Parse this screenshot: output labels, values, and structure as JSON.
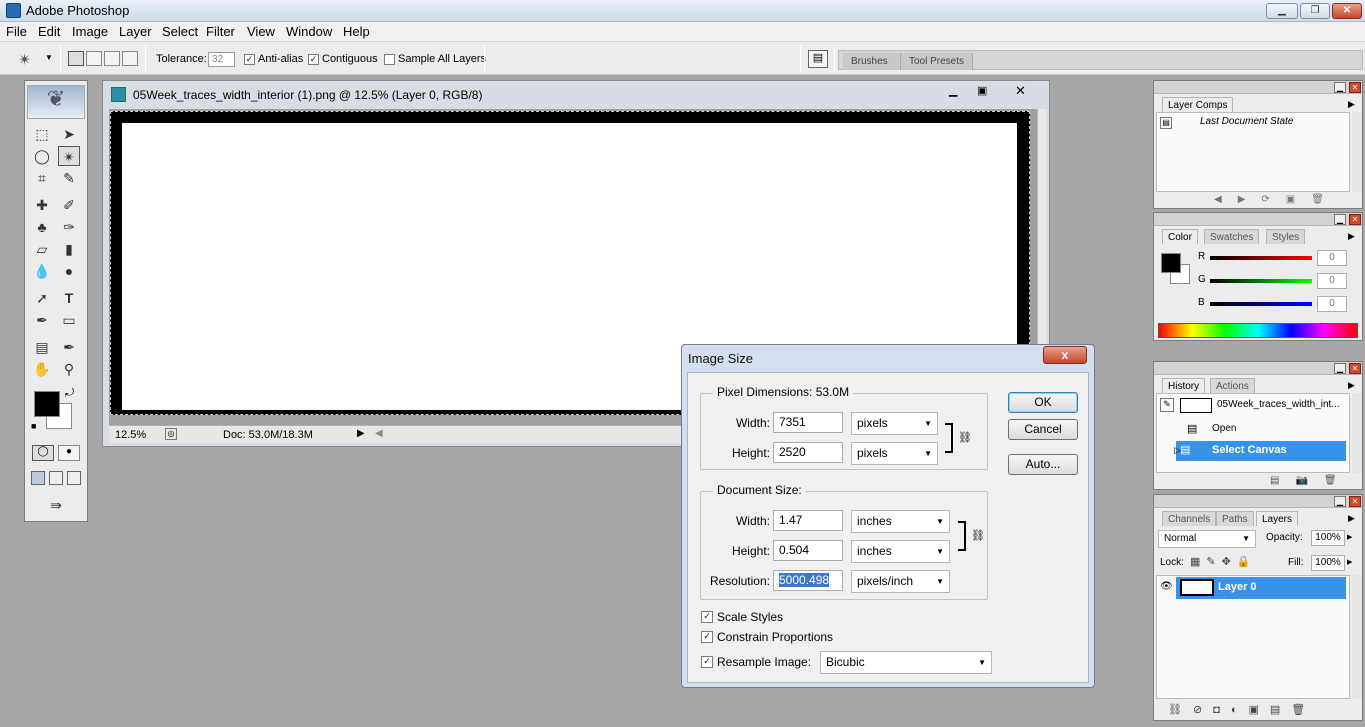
{
  "app": {
    "title": "Adobe Photoshop"
  },
  "menu": [
    "File",
    "Edit",
    "Image",
    "Layer",
    "Select",
    "Filter",
    "View",
    "Window",
    "Help"
  ],
  "options": {
    "tolerance_label": "Tolerance:",
    "tolerance_value": "32",
    "antialias_label": "Anti-alias",
    "contiguous_label": "Contiguous",
    "sample_all_label": "Sample All Layers",
    "antialias_checked": true,
    "contiguous_checked": true,
    "sample_all_checked": false
  },
  "well_tabs": [
    "Brushes",
    "Tool Presets"
  ],
  "document": {
    "title": "05Week_traces_width_interior (1).png @ 12.5% (Layer 0, RGB/8)",
    "zoom": "12.5%",
    "doc_info": "Doc: 53.0M/18.3M"
  },
  "dialog": {
    "title": "Image Size",
    "pixel_dims_label": "Pixel Dimensions:",
    "pixel_dims_value": "53.0M",
    "width_label": "Width:",
    "height_label": "Height:",
    "px_width": "7351",
    "px_height": "2520",
    "px_unit": "pixels",
    "doc_size_label": "Document Size:",
    "doc_width": "1.47",
    "doc_height": "0.504",
    "doc_unit": "inches",
    "resolution_label": "Resolution:",
    "resolution": "5000.498",
    "res_unit": "pixels/inch",
    "scale_styles": "Scale Styles",
    "constrain": "Constrain Proportions",
    "resample": "Resample Image:",
    "resample_method": "Bicubic",
    "ok": "OK",
    "cancel": "Cancel",
    "auto": "Auto...",
    "close": "x"
  },
  "layer_comps": {
    "tab": "Layer Comps",
    "row": "Last Document State"
  },
  "color_panel": {
    "tabs": [
      "Color",
      "Swatches",
      "Styles"
    ],
    "channels": [
      {
        "name": "R",
        "value": "0",
        "color": "#d62020"
      },
      {
        "name": "G",
        "value": "0",
        "color": "#22b022"
      },
      {
        "name": "B",
        "value": "0",
        "color": "#2020d6"
      }
    ]
  },
  "history_panel": {
    "tabs": [
      "History",
      "Actions"
    ],
    "snapshot": "05Week_traces_width_int...",
    "items": [
      "Open",
      "Select Canvas"
    ]
  },
  "layers_panel": {
    "tabs": [
      "Channels",
      "Paths",
      "Layers"
    ],
    "blend_mode": "Normal",
    "opacity_label": "Opacity:",
    "opacity": "100%",
    "lock_label": "Lock:",
    "fill_label": "Fill:",
    "fill": "100%",
    "layer_name": "Layer 0"
  }
}
